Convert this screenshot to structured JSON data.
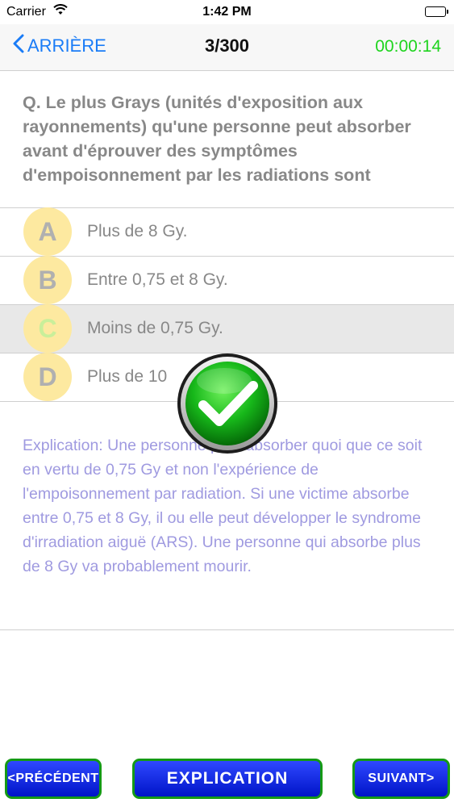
{
  "status_bar": {
    "carrier": "Carrier",
    "time": "1:42 PM",
    "icons": [
      "wifi-icon",
      "battery-icon"
    ]
  },
  "nav": {
    "back_label": "ARRIÈRE",
    "title": "3/300",
    "timer": "00:00:14",
    "colors": {
      "back": "#1a7cf7",
      "timer": "#1ed41e"
    }
  },
  "question": {
    "text": "Q. Le plus Grays (unités d'exposition aux rayonnements) qu'une personne peut absorber avant d'éprouver des symptômes d'empoisonnement par les radiations sont"
  },
  "answers": [
    {
      "letter": "A",
      "text": "Plus de 8 Gy.",
      "selected": false
    },
    {
      "letter": "B",
      "text": "Entre 0,75 et 8 Gy.",
      "selected": false
    },
    {
      "letter": "C",
      "text": "Moins de 0,75 Gy.",
      "selected": true
    },
    {
      "letter": "D",
      "text": "Plus de 10",
      "selected": false
    }
  ],
  "result_icon": "check-icon",
  "explanation": {
    "text": "Explication: Une personne peut absorber quoi que ce soit en vertu de 0,75 Gy et non l'expérience de l'empoisonnement par radiation. Si une victime absorbe entre 0,75 et 8 Gy, il ou elle peut développer le syndrome d'irradiation aiguë (ARS). Une personne qui absorbe plus de 8 Gy va probablement mourir."
  },
  "buttons": {
    "prev": "<PRÉCÉDENT",
    "explain": "EXPLICATION",
    "next": "SUIVANT>"
  }
}
